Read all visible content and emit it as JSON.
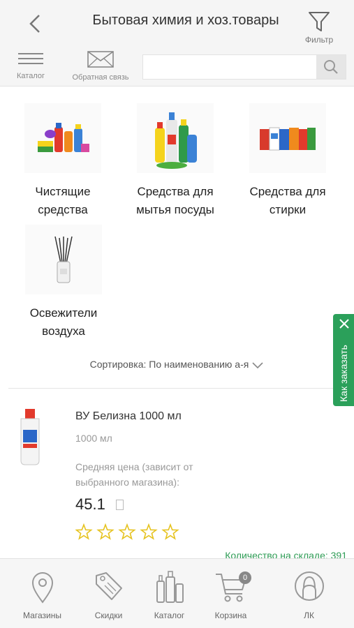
{
  "header": {
    "title": "Бытовая химия и хоз.товары",
    "filter_label": "Фильтр"
  },
  "toolbar": {
    "catalog_label": "Каталог",
    "feedback_label": "Обратная связь",
    "search_value": ""
  },
  "categories": [
    {
      "name": "Чистящие средства"
    },
    {
      "name": "Средства для мытья посуды"
    },
    {
      "name": "Средства для стирки"
    },
    {
      "name": "Освежители воздуха"
    }
  ],
  "sort": {
    "label": "Сортировка: По наименованию а-я"
  },
  "product": {
    "name": "ВУ Белизна 1000 мл",
    "volume": "1000 мл",
    "price_note": "Средняя цена (зависит от выбранного магазина):",
    "price": "45.1",
    "rating": 0,
    "rating_max": 5,
    "stock": "Количество на складе: 391"
  },
  "side_tab": {
    "label": "Как заказать"
  },
  "bottom_nav": [
    {
      "label": "Магазины",
      "icon": "map-pin-icon"
    },
    {
      "label": "Скидки",
      "icon": "discount-tag-icon"
    },
    {
      "label": "Каталог",
      "icon": "catalog-bottles-icon"
    },
    {
      "label": "Корзина",
      "icon": "cart-icon",
      "badge": "0"
    },
    {
      "label": "ЛК",
      "icon": "user-icon"
    }
  ],
  "colors": {
    "accent": "#2ba05a",
    "star": "#e6c320",
    "stock_text": "#2e9c55"
  }
}
